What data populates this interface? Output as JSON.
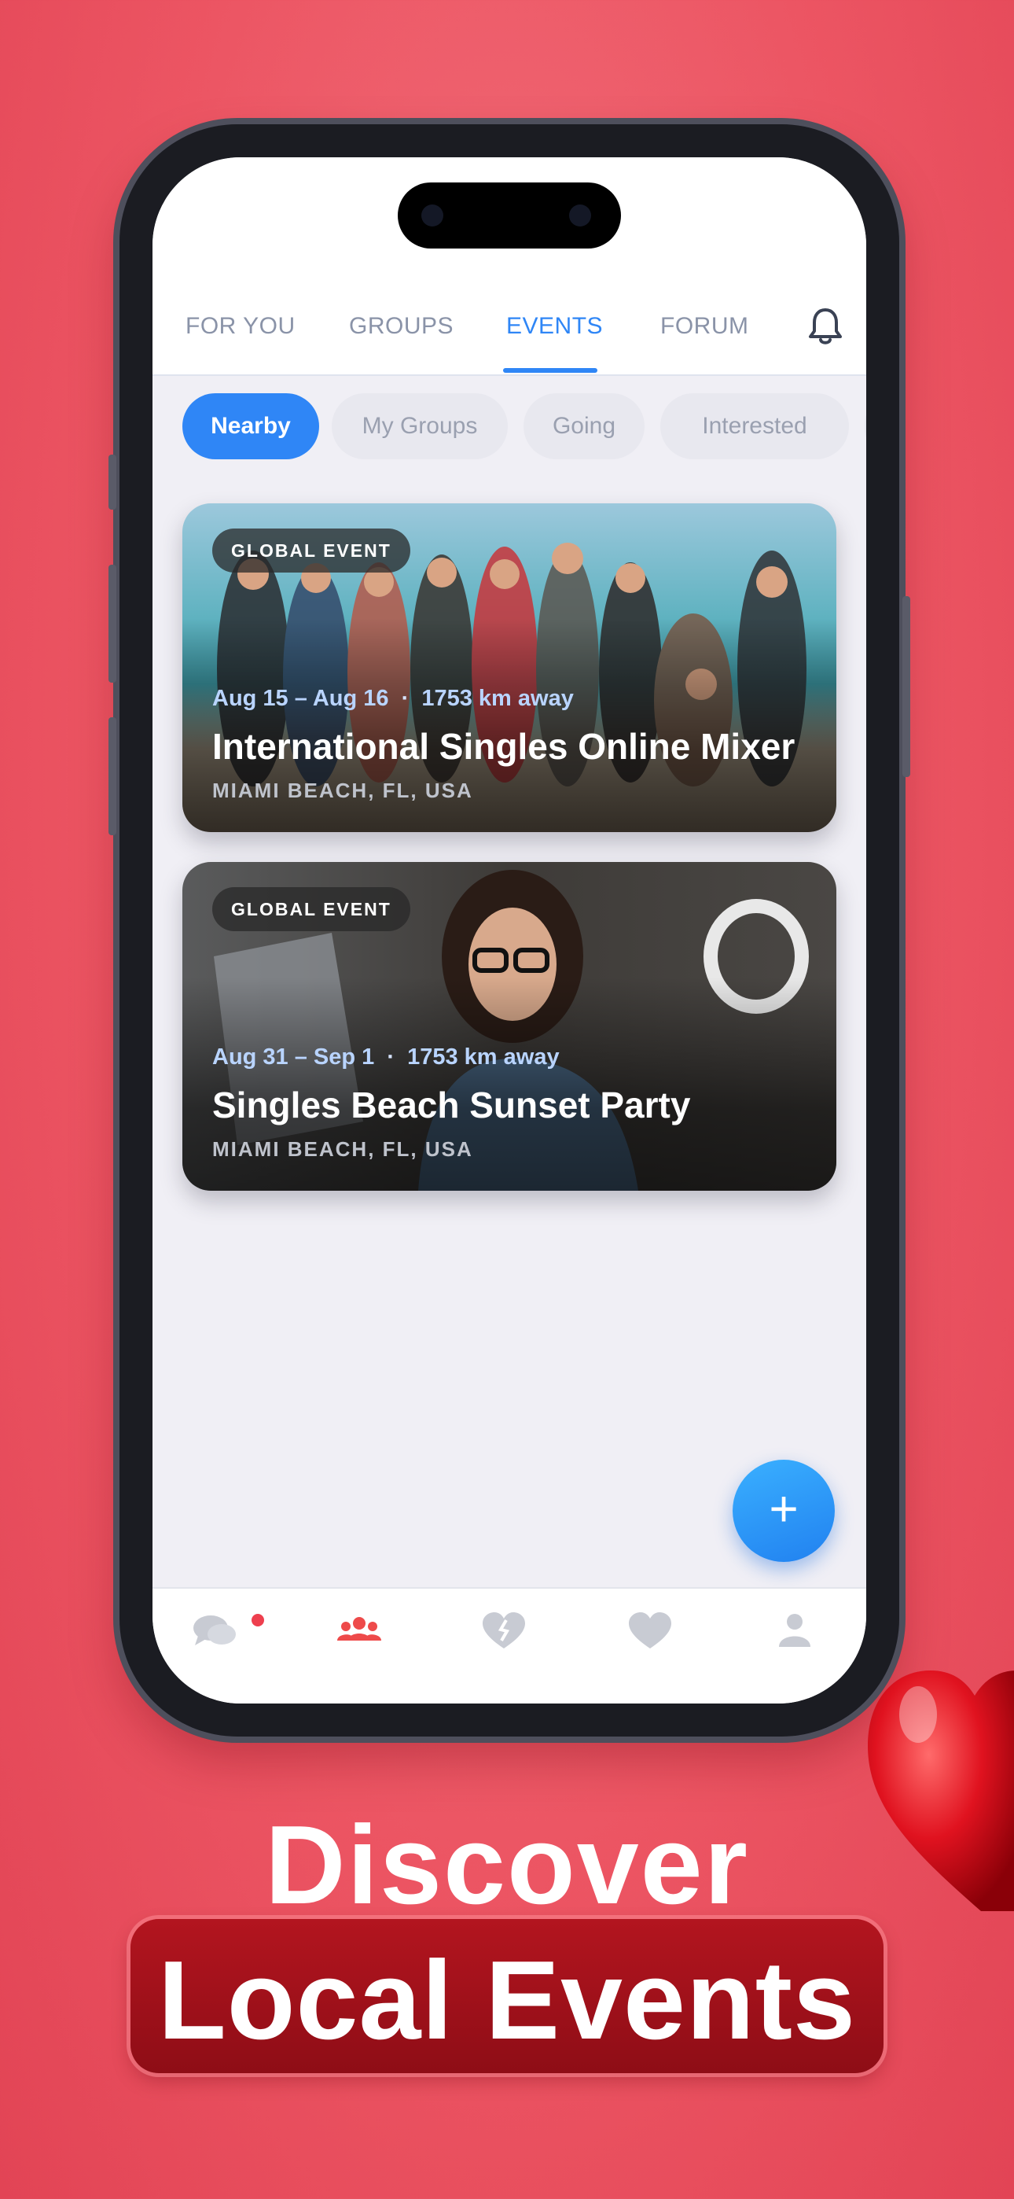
{
  "tabs": [
    {
      "label": "FOR YOU"
    },
    {
      "label": "GROUPS"
    },
    {
      "label": "EVENTS"
    },
    {
      "label": "FORUM"
    }
  ],
  "chips": [
    {
      "label": "Nearby"
    },
    {
      "label": "My Groups"
    },
    {
      "label": "Going"
    },
    {
      "label": "Interested"
    }
  ],
  "events": [
    {
      "badge": "GLOBAL EVENT",
      "dates": "Aug 15 – Aug 16",
      "distance": "1753 km away",
      "title": "International Singles Online Mixer",
      "location": "MIAMI BEACH, FL, USA"
    },
    {
      "badge": "GLOBAL EVENT",
      "dates": "Aug 31 – Sep 1",
      "distance": "1753 km away",
      "title": "Singles Beach Sunset Party",
      "location": "MIAMI BEACH, FL, USA"
    }
  ],
  "meta_separator": "·",
  "fab_label": "+",
  "promo": {
    "line1": "Discover",
    "line2": "Local Events"
  },
  "colors": {
    "accent": "#2f86f6",
    "background": "#ec5563",
    "banner": "#a3121c",
    "nav_active": "#ee4a4a"
  }
}
